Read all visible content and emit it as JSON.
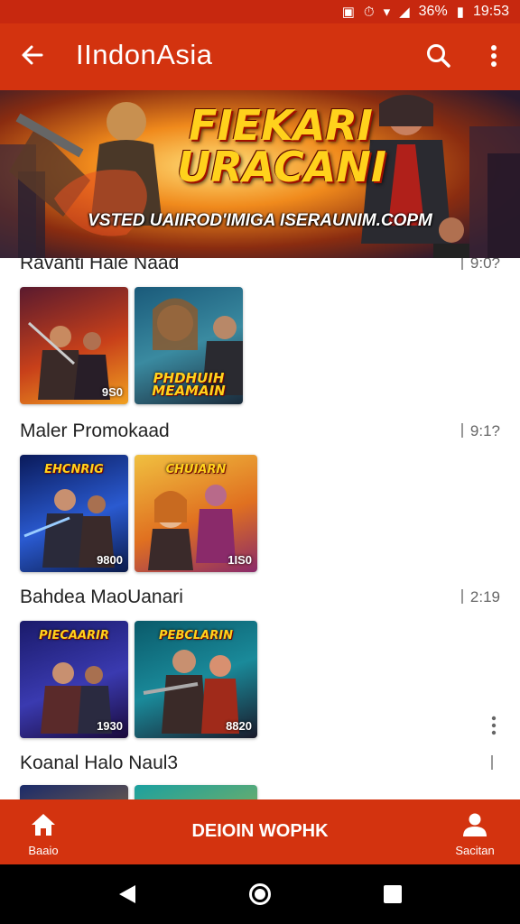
{
  "status_bar": {
    "battery": "36%",
    "time": "19:53"
  },
  "app_bar": {
    "title": "IIndonAsia"
  },
  "banner": {
    "title": "FIEKARI URACANI",
    "subtitle": "VSTED UAIIROD'IMIGA ISERAUNIM.COPM"
  },
  "sections": [
    {
      "title": "Ravanti Hale Naad",
      "time": "9:0?",
      "tiles": [
        {
          "label": "",
          "price": "9S0"
        },
        {
          "label": "PHDHUIH MEAMAIN",
          "price": ""
        }
      ]
    },
    {
      "title": "Maler Promokaad",
      "time": "9:1?",
      "tiles": [
        {
          "label": "EHCNRIG",
          "price": "9800"
        },
        {
          "label": "CHUIARN",
          "price": "1IS0"
        }
      ]
    },
    {
      "title": "Bahdea MaoUanari",
      "time": "2:19",
      "tiles": [
        {
          "label": "PIECAARIR",
          "price": "1930"
        },
        {
          "label": "PEBCLARIN",
          "price": "8820"
        }
      ]
    },
    {
      "title": "Koanal Halo Naul3",
      "time": "",
      "tiles": [
        {
          "label": "",
          "price": ""
        },
        {
          "label": "",
          "price": ""
        }
      ]
    }
  ],
  "bottom_nav": {
    "home_label": "Baaio",
    "center_label": "DEIOIN WOPHK",
    "profile_label": "Sacitan"
  },
  "colors": {
    "primary": "#d3330f",
    "status": "#c7280f"
  },
  "icons": [
    "back-arrow-icon",
    "search-icon",
    "more-vert-icon",
    "home-icon",
    "profile-icon",
    "back-triangle-icon",
    "home-circle-icon",
    "recents-square-icon"
  ]
}
